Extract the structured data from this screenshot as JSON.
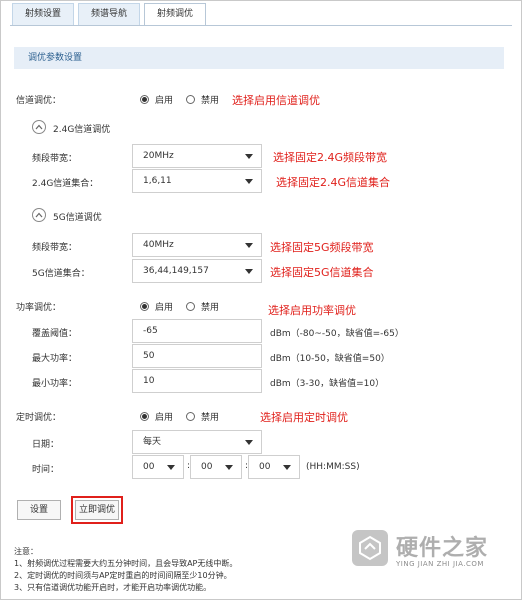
{
  "tabs": [
    {
      "label": "射频设置"
    },
    {
      "label": "频谱导航"
    },
    {
      "label": "射频调优"
    }
  ],
  "section_title": "调优参数设置",
  "channel_tuning": {
    "label": "信道调优：",
    "options": [
      "启用",
      "禁用"
    ],
    "selected": "启用",
    "note": "选择启用信道调优"
  },
  "band24": {
    "title": "2.4G信道调优",
    "bandwidth_label": "频段带宽：",
    "bandwidth_value": "20MHz",
    "bandwidth_note": "选择固定2.4G频段带宽",
    "channel_set_label": "2.4G信道集合：",
    "channel_set_value": "1,6,11",
    "channel_set_note": "选择固定2.4G信道集合"
  },
  "band5": {
    "title": "5G信道调优",
    "bandwidth_label": "频段带宽：",
    "bandwidth_value": "40MHz",
    "bandwidth_note": "选择固定5G频段带宽",
    "channel_set_label": "5G信道集合：",
    "channel_set_value": "36,44,149,157",
    "channel_set_note": "选择固定5G信道集合"
  },
  "power_tuning": {
    "label": "功率调优：",
    "options": [
      "启用",
      "禁用"
    ],
    "selected": "启用",
    "note": "选择启用功率调优",
    "coverage_label": "覆盖阈值：",
    "coverage_value": "-65",
    "coverage_hint": "dBm（-80~-50，缺省值=-65）",
    "max_power_label": "最大功率：",
    "max_power_value": "50",
    "max_power_hint": "dBm（10-50，缺省值=50）",
    "min_power_label": "最小功率：",
    "min_power_value": "10",
    "min_power_hint": "dBm（3-30，缺省值=10）"
  },
  "scheduled_tuning": {
    "label": "定时调优：",
    "options": [
      "启用",
      "禁用"
    ],
    "selected": "启用",
    "note": "选择启用定时调优",
    "date_label": "日期：",
    "date_value": "每天",
    "time_label": "时间：",
    "hour": "00",
    "minute": "00",
    "second": "00",
    "separator": ":",
    "time_hint": "(HH:MM:SS)"
  },
  "buttons": {
    "settings": "设置",
    "tune_now": "立即调优"
  },
  "notes": {
    "title": "注意：",
    "items": [
      "1、射频调优过程需要大约五分钟时间，且会导致AP无线中断。",
      "2、定时调优的时间须与AP定时重启的时间间隔至少10分钟。",
      "3、只有信道调优功能开启时，才能开启功率调优功能。"
    ]
  },
  "watermark": {
    "name": "硬件之家",
    "sub": "YING JIAN ZHI JIA.COM"
  },
  "colors": {
    "annotation_red": "#e0201b",
    "section_bg": "#e6eef7",
    "section_text": "#2b5f8f"
  }
}
